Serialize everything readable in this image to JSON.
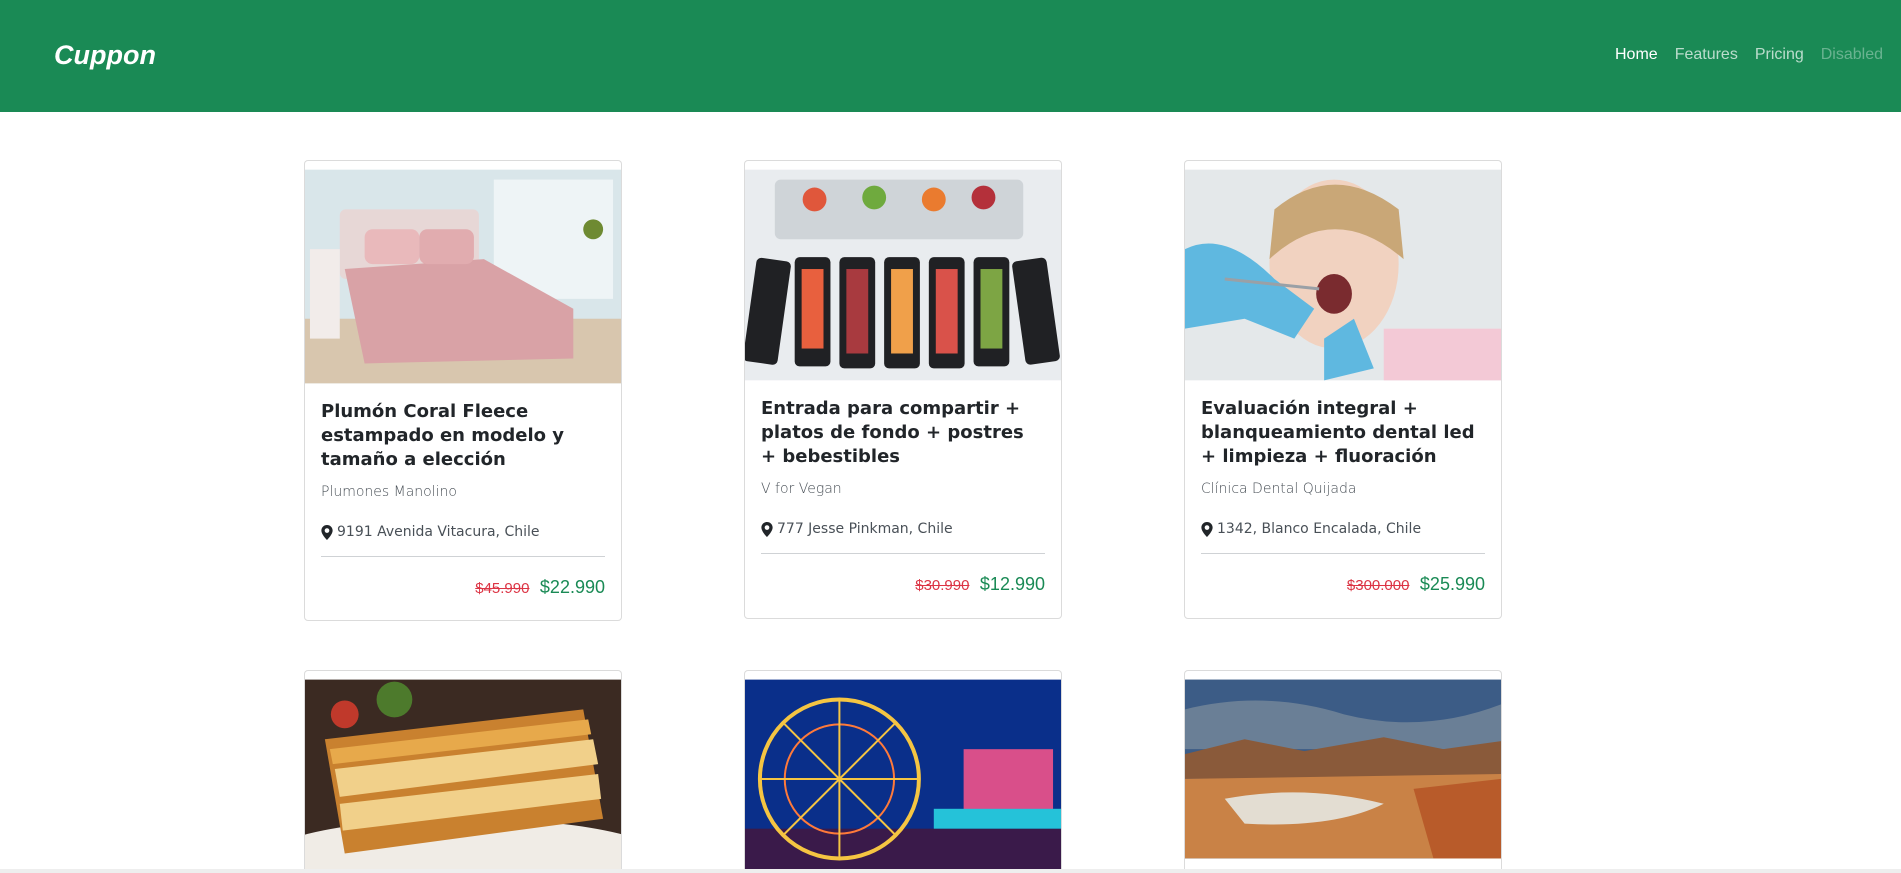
{
  "navbar": {
    "brand": "Cuppon",
    "links": [
      "Home",
      "Features",
      "Pricing",
      "Disabled"
    ],
    "color": "#1a8a55"
  },
  "cards": [
    {
      "title": "Plumón Coral Fleece estampado en modelo y tamaño a elección",
      "merchant": "Plumones Manolino",
      "location": "9191 Avenida Vitacura, Chile",
      "old_price": "$45.990",
      "new_price": "$22.990",
      "image": "pink-bed-photo"
    },
    {
      "title": "Entrada para compartir + platos de fondo + postres + bebestibles",
      "merchant": "V for Vegan",
      "location": "777 Jesse Pinkman, Chile",
      "old_price": "$30.990",
      "new_price": "$12.990",
      "image": "buffet-trays-photo"
    },
    {
      "title": "Evaluación integral + blanqueamiento dental led + limpieza + fluoración",
      "merchant": "Clínica Dental Quijada",
      "location": "1342, Blanco Encalada, Chile",
      "old_price": "$300.000",
      "new_price": "$25.990",
      "image": "dental-patient-photo"
    },
    {
      "image": "lasagna-photo"
    },
    {
      "image": "ferris-wheel-night-photo"
    },
    {
      "image": "desert-valley-photo"
    }
  ]
}
